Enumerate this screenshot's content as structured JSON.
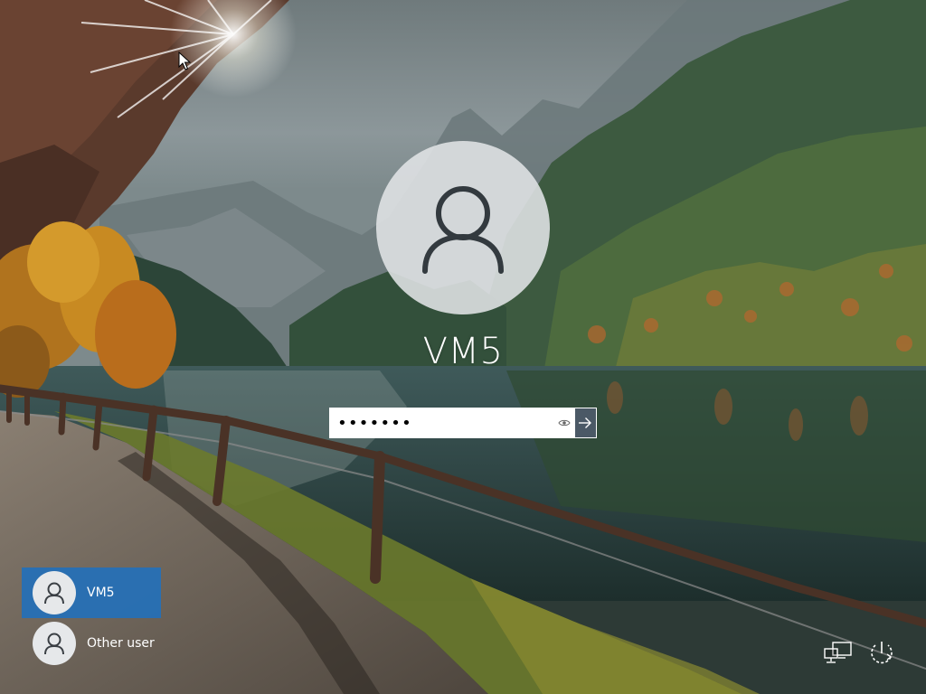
{
  "lock_screen": {
    "account_name": "VM5",
    "password_field": {
      "value": "•••••••",
      "masked_length": 7
    }
  },
  "user_switcher": {
    "users": [
      {
        "label": "VM5",
        "selected": true
      },
      {
        "label": "Other user",
        "selected": false
      }
    ]
  },
  "system_icons": {
    "network": "network-icon",
    "power": "power-icon"
  },
  "colors": {
    "selected_tile": "#2470b8",
    "submit_button": "#4b5966",
    "avatar_bg": "#e1e4e6"
  }
}
